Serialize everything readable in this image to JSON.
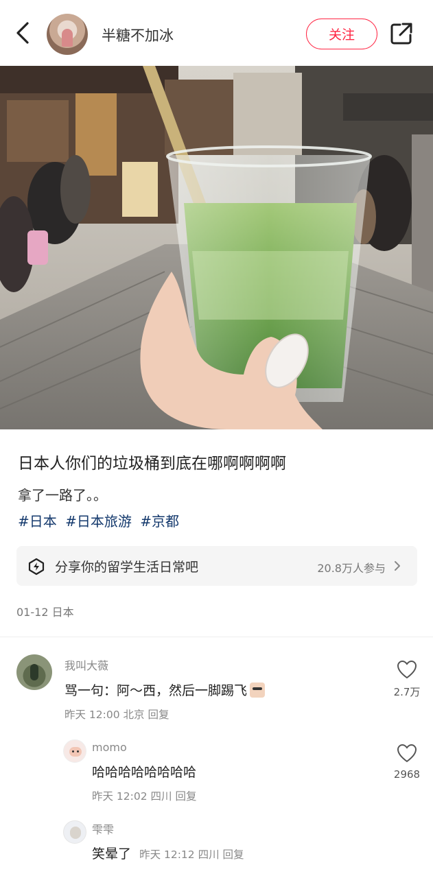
{
  "header": {
    "username": "半糖不加冰",
    "follow_label": "关注"
  },
  "post": {
    "title": "日本人你们的垃圾桶到底在哪啊啊啊啊",
    "body": "拿了一路了。。",
    "tags": [
      "#日本",
      "#日本旅游",
      "#京都"
    ],
    "topic": {
      "label": "分享你的留学生活日常吧",
      "count": "20.8万人参与"
    },
    "date_location": "01-12 日本"
  },
  "comments": [
    {
      "name": "我叫大薇",
      "text": "骂一句：阿～西，然后一脚踢飞",
      "meta": "昨天 12:00 北京 回复",
      "likes": "2.7万"
    },
    {
      "name": "momo",
      "text": "哈哈哈哈哈哈哈哈",
      "meta": "昨天 12:02 四川 回复",
      "likes": "2968"
    },
    {
      "name": "雫雫",
      "text": "笑晕了",
      "meta": "昨天 12:12 四川 回复"
    }
  ],
  "colors": {
    "accent": "#ff2442",
    "tag": "#13386c",
    "matcha": "#5a9a3a"
  }
}
